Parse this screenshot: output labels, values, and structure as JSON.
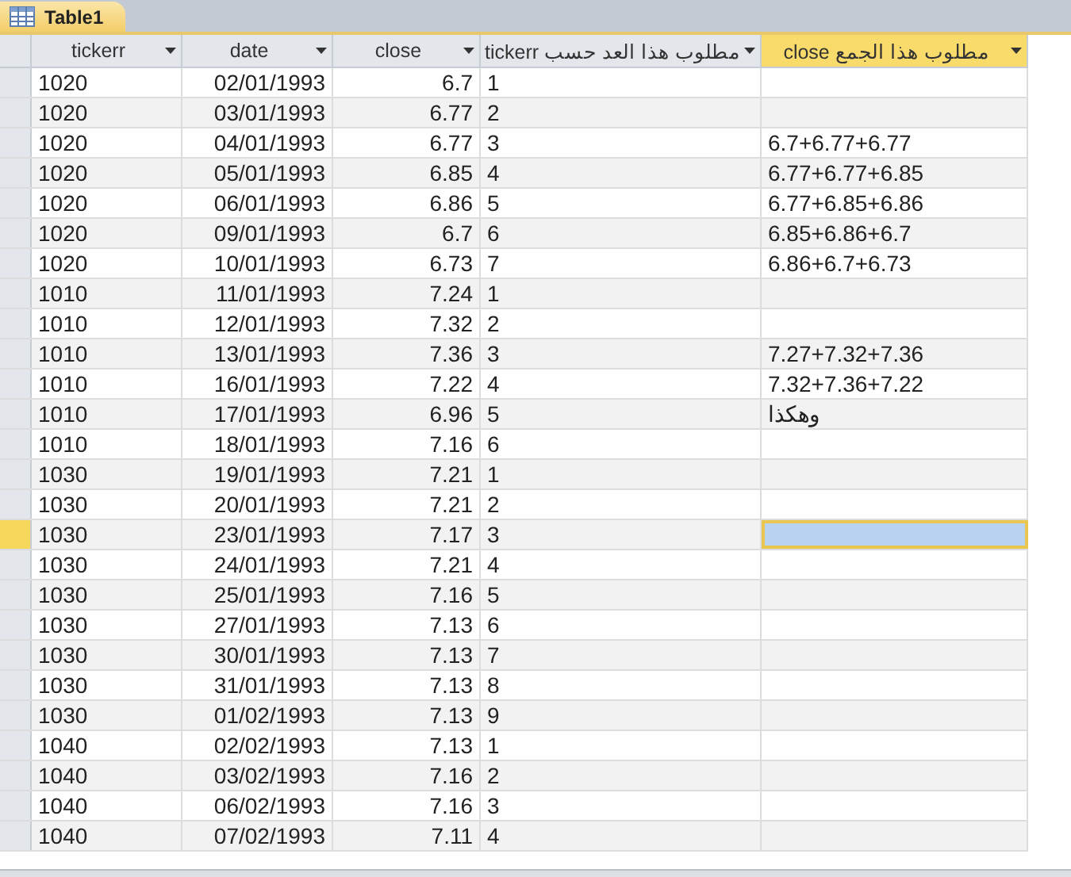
{
  "document_tab": {
    "label": "Table1",
    "selected": true
  },
  "table": {
    "columns": [
      {
        "label": "tickerr",
        "selected": false
      },
      {
        "label": "date",
        "selected": false
      },
      {
        "label": "close",
        "selected": false
      },
      {
        "label": "مطلوب هذا العد حسب tickerr",
        "selected": false
      },
      {
        "label": "مطلوب هذا الجمع close",
        "selected": true
      }
    ],
    "rows": [
      {
        "selected": false,
        "cells": [
          "1020",
          "02/01/1993",
          "6.7",
          "1",
          ""
        ]
      },
      {
        "selected": false,
        "cells": [
          "1020",
          "03/01/1993",
          "6.77",
          "2",
          ""
        ]
      },
      {
        "selected": false,
        "cells": [
          "1020",
          "04/01/1993",
          "6.77",
          "3",
          "6.7+6.77+6.77"
        ]
      },
      {
        "selected": false,
        "cells": [
          "1020",
          "05/01/1993",
          "6.85",
          "4",
          "6.77+6.77+6.85"
        ]
      },
      {
        "selected": false,
        "cells": [
          "1020",
          "06/01/1993",
          "6.86",
          "5",
          "6.77+6.85+6.86"
        ]
      },
      {
        "selected": false,
        "cells": [
          "1020",
          "09/01/1993",
          "6.7",
          "6",
          "6.85+6.86+6.7"
        ]
      },
      {
        "selected": false,
        "cells": [
          "1020",
          "10/01/1993",
          "6.73",
          "7",
          "6.86+6.7+6.73"
        ]
      },
      {
        "selected": false,
        "cells": [
          "1010",
          "11/01/1993",
          "7.24",
          "1",
          ""
        ]
      },
      {
        "selected": false,
        "cells": [
          "1010",
          "12/01/1993",
          "7.32",
          "2",
          ""
        ]
      },
      {
        "selected": false,
        "cells": [
          "1010",
          "13/01/1993",
          "7.36",
          "3",
          "7.27+7.32+7.36"
        ]
      },
      {
        "selected": false,
        "cells": [
          "1010",
          "16/01/1993",
          "7.22",
          "4",
          "7.32+7.36+7.22"
        ]
      },
      {
        "selected": false,
        "cells": [
          "1010",
          "17/01/1993",
          "6.96",
          "5",
          "وهكذا"
        ]
      },
      {
        "selected": false,
        "cells": [
          "1010",
          "18/01/1993",
          "7.16",
          "6",
          ""
        ]
      },
      {
        "selected": false,
        "cells": [
          "1030",
          "19/01/1993",
          "7.21",
          "1",
          ""
        ]
      },
      {
        "selected": false,
        "cells": [
          "1030",
          "20/01/1993",
          "7.21",
          "2",
          ""
        ]
      },
      {
        "selected": true,
        "cells": [
          "1030",
          "23/01/1993",
          "7.17",
          "3",
          ""
        ]
      },
      {
        "selected": false,
        "cells": [
          "1030",
          "24/01/1993",
          "7.21",
          "4",
          ""
        ]
      },
      {
        "selected": false,
        "cells": [
          "1030",
          "25/01/1993",
          "7.16",
          "5",
          ""
        ]
      },
      {
        "selected": false,
        "cells": [
          "1030",
          "27/01/1993",
          "7.13",
          "6",
          ""
        ]
      },
      {
        "selected": false,
        "cells": [
          "1030",
          "30/01/1993",
          "7.13",
          "7",
          ""
        ]
      },
      {
        "selected": false,
        "cells": [
          "1030",
          "31/01/1993",
          "7.13",
          "8",
          ""
        ]
      },
      {
        "selected": false,
        "cells": [
          "1030",
          "01/02/1993",
          "7.13",
          "9",
          ""
        ]
      },
      {
        "selected": false,
        "cells": [
          "1040",
          "02/02/1993",
          "7.13",
          "1",
          ""
        ]
      },
      {
        "selected": false,
        "cells": [
          "1040",
          "03/02/1993",
          "7.16",
          "2",
          ""
        ]
      },
      {
        "selected": false,
        "cells": [
          "1040",
          "06/02/1993",
          "7.16",
          "3",
          ""
        ]
      },
      {
        "selected": false,
        "cells": [
          "1040",
          "07/02/1993",
          "7.11",
          "4",
          ""
        ]
      }
    ]
  }
}
